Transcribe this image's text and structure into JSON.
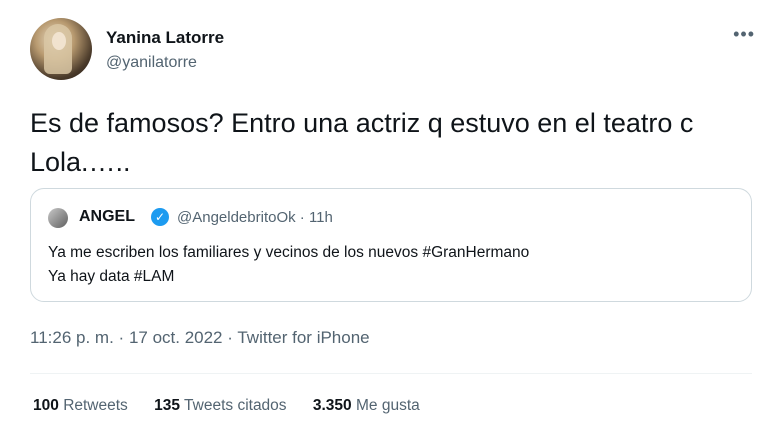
{
  "author": {
    "name": "Yanina Latorre",
    "handle": "@yanilatorre"
  },
  "more_icon": "more-dots-icon",
  "tweet": {
    "text_line1": "Es de famosos? Entro una actriz q estuvo en el teatro c",
    "text_line2": "Lola.…..",
    "time": "11:26 p. m.",
    "sep1": "·",
    "date": "17 oct. 2022",
    "sep2": "·",
    "source": "Twitter for iPhone"
  },
  "quote": {
    "name": "ANGEL",
    "verified": "✓",
    "handle_time": "@AngeldebritoOk · 11h",
    "line1": "Ya me escriben los familiares y vecinos de los nuevos #GranHermano",
    "line2": "Ya hay data #LAM"
  },
  "stats": {
    "retweets_count": "100",
    "retweets_label": "Retweets",
    "quotes_count": "135",
    "quotes_label": "Tweets citados",
    "likes_count": "3.350",
    "likes_label": "Me gusta"
  },
  "colors": {
    "verified": "#1d9bf0",
    "secondary_text": "#536471",
    "border": "#cfd9de"
  }
}
